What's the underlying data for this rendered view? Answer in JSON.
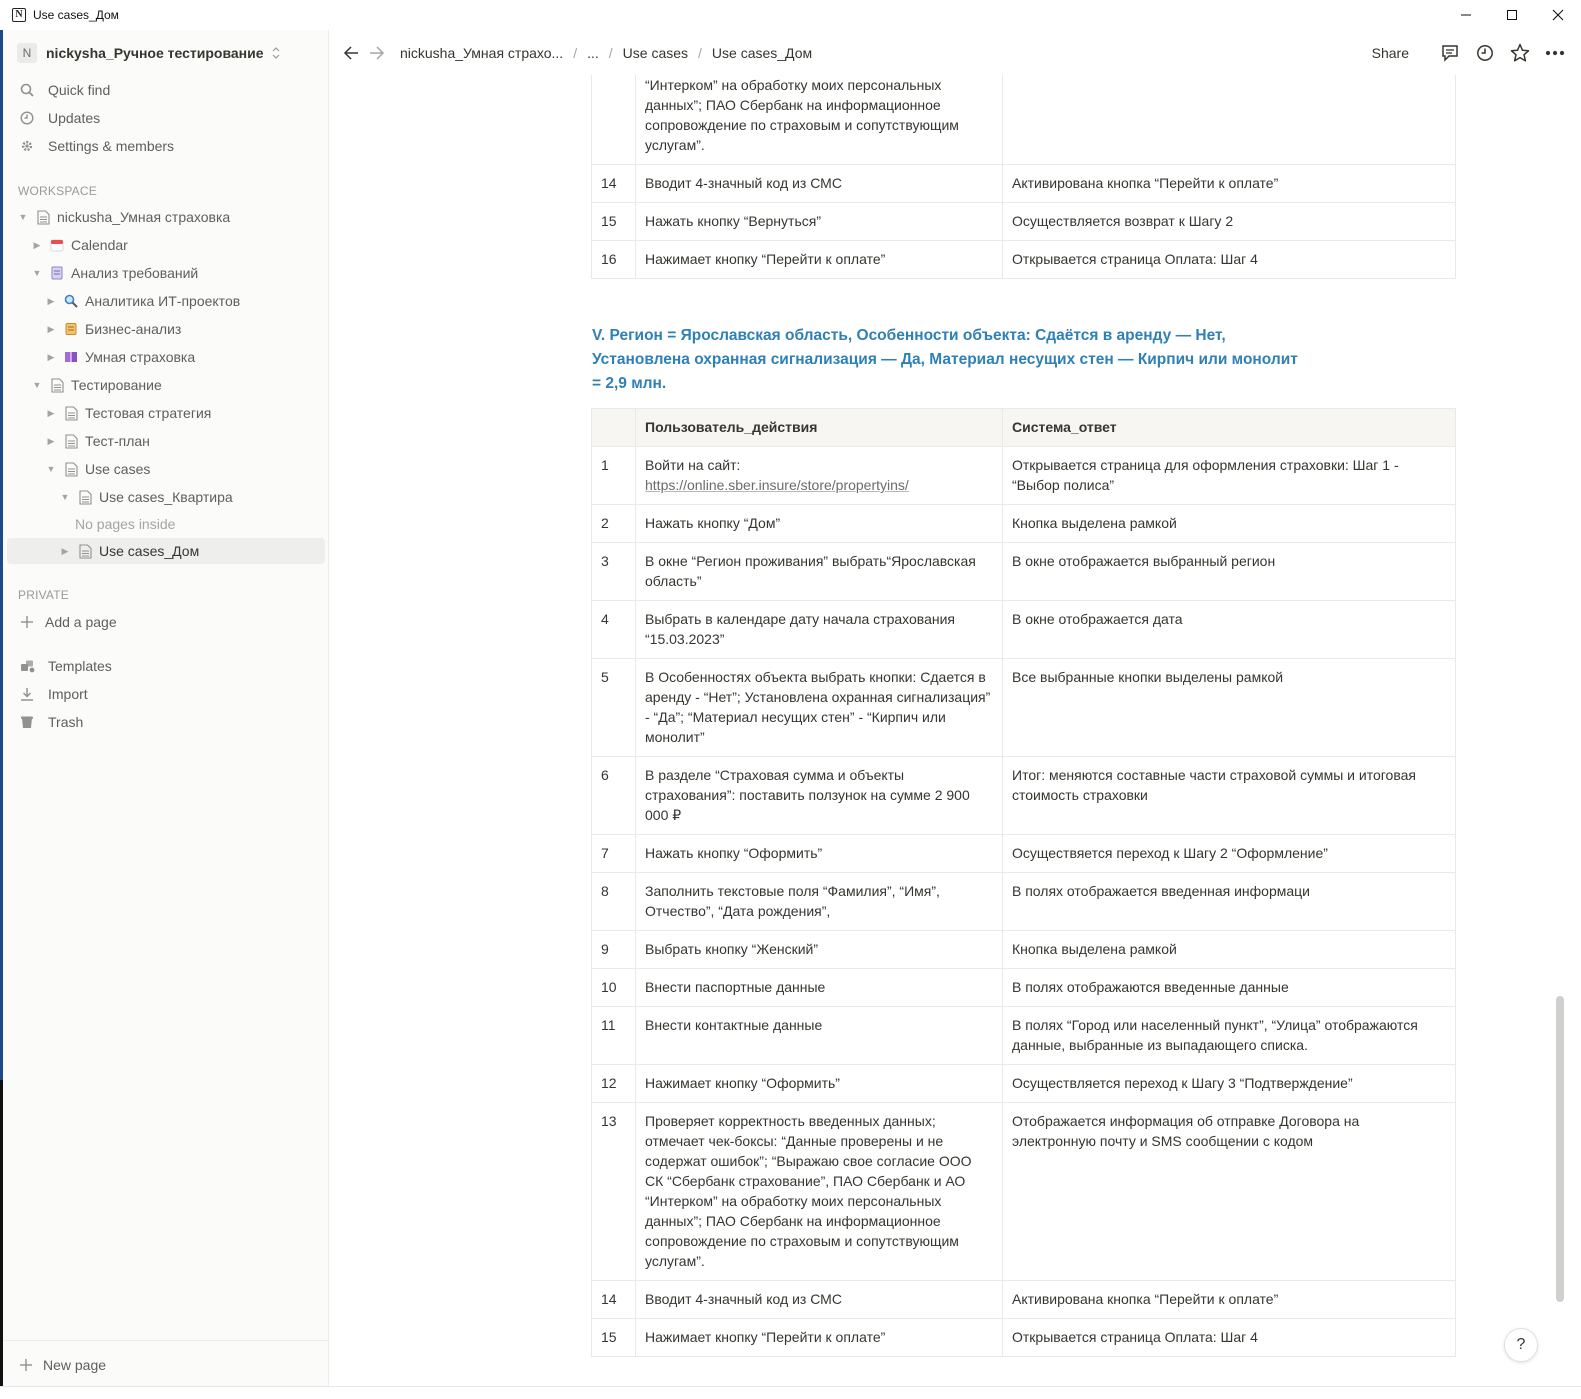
{
  "window": {
    "title": "Use cases_Дом",
    "app_icon_letter": "N"
  },
  "sidebar": {
    "workspace_initial": "N",
    "workspace_name": "nickysha_Ручное тестирование",
    "actions": [
      {
        "label": "Quick find",
        "icon": "search-icon"
      },
      {
        "label": "Updates",
        "icon": "clock-icon"
      },
      {
        "label": "Settings & members",
        "icon": "gear-icon"
      }
    ],
    "workspace_label": "WORKSPACE",
    "tree": [
      {
        "label": "nickusha_Умная страховка",
        "icon": "page-icon",
        "expanded": true
      },
      {
        "label": "Calendar",
        "icon": "calendar-icon",
        "expanded": false
      },
      {
        "label": "Анализ требований",
        "icon": "notes-icon",
        "expanded": true
      },
      {
        "label": "Аналитика ИТ-проектов",
        "icon": "magnifier-icon",
        "expanded": false
      },
      {
        "label": "Бизнес-анализ",
        "icon": "scroll-icon",
        "expanded": false
      },
      {
        "label": "Умная страховка",
        "icon": "book-icon",
        "expanded": false
      },
      {
        "label": "Тестирование",
        "icon": "page-icon",
        "expanded": true
      },
      {
        "label": "Тестовая стратегия",
        "icon": "page-icon",
        "expanded": false
      },
      {
        "label": "Тест-план",
        "icon": "page-icon",
        "expanded": false
      },
      {
        "label": "Use cases",
        "icon": "page-icon",
        "expanded": true
      },
      {
        "label": "Use cases_Квартира",
        "icon": "page-icon",
        "expanded": true
      },
      {
        "label": "Use cases_Дом",
        "icon": "page-icon",
        "expanded": false,
        "active": true
      }
    ],
    "no_pages_text": "No pages inside",
    "private_label": "PRIVATE",
    "add_page": "Add a page",
    "bottom_actions": [
      {
        "label": "Templates",
        "icon": "templates-icon"
      },
      {
        "label": "Import",
        "icon": "import-icon"
      },
      {
        "label": "Trash",
        "icon": "trash-icon"
      }
    ],
    "new_page": "New page"
  },
  "topbar": {
    "breadcrumbs": [
      "nickusha_Умная страхо...",
      "...",
      "Use cases",
      "Use cases_Дом"
    ],
    "share": "Share"
  },
  "main": {
    "top_table_rows": [
      {
        "num": "",
        "action": "“Интерком” на обработку моих персональных данных”; ПАО Сбербанк на информационное сопровождение по страховым и сопутствующим услугам”.",
        "result": ""
      },
      {
        "num": "14",
        "action": "Вводит 4-значный код из СМС",
        "result": "Активирована кнопка “Перейти к оплате”"
      },
      {
        "num": "15",
        "action": "Нажать кнопку “Вернуться”",
        "result": "Осуществляется возврат к Шагу 2"
      },
      {
        "num": "16",
        "action": "Нажимает кнопку “Перейти к оплате”",
        "result": "Открывается страница Оплата: Шаг 4"
      }
    ],
    "heading": "V. Регион = Ярославская область, Особенности объекта: Сдаётся в аренду — Нет, Установлена охранная сигнализация — Да, Материал несущих стен — Кирпич или монолит = 2,9 млн.",
    "table_header": {
      "num": "",
      "action": "Пользователь_действия",
      "result": "Система_ответ"
    },
    "table_rows": [
      {
        "num": "1",
        "action": "Войти на сайт:",
        "link": "https://online.sber.insure/store/propertyins/",
        "result": "Открывается страница для оформления страховки: Шаг 1 - “Выбор полиса”"
      },
      {
        "num": "2",
        "action": "Нажать кнопку “Дом”",
        "result": "Кнопка выделена рамкой"
      },
      {
        "num": "3",
        "action": "В окне “Регион проживания” выбрать“Ярославская область”",
        "result": "В окне отображается выбранный регион"
      },
      {
        "num": "4",
        "action": "Выбрать в календаре дату начала страхования “15.03.2023”",
        "result": "В окне отображается дата"
      },
      {
        "num": "5",
        "action": "В Особенностях объекта выбрать кнопки: Сдается в аренду - “Нет”; Установлена охранная сигнализация” - “Да”; “Материал несущих стен” - “Кирпич или монолит”",
        "result": "Все выбранные кнопки выделены рамкой"
      },
      {
        "num": "6",
        "action": "В разделе “Страховая сумма и объекты страхования”: поставить ползунок на сумме 2 900 000 ₽",
        "result": "Итог: меняются составные части страховой суммы и итоговая стоимость страховки"
      },
      {
        "num": "7",
        "action": "Нажать кнопку “Оформить”",
        "result": "Осуществяется переход  к Шагу 2 “Оформление”"
      },
      {
        "num": "8",
        "action": "Заполнить текстовые поля “Фамилия”, “Имя”, Отчество”, “Дата рождения”,",
        "result": "В полях отображается введенная информаци"
      },
      {
        "num": "9",
        "action": "Выбрать кнопку “Женский”",
        "result": "Кнопка выделена рамкой"
      },
      {
        "num": "10",
        "action": "Внести паспортные данные",
        "result": "В полях отображаются введенные данные"
      },
      {
        "num": "11",
        "action": "Внести контактные данные",
        "result": "В полях “Город или населенный пункт”, “Улица” отображаются данные, выбранные из выпадающего списка."
      },
      {
        "num": "12",
        "action": "Нажимает кнопку “Оформить”",
        "result": "Осуществляется переход к Шагу 3 “Подтверждение”"
      },
      {
        "num": "13",
        "action": "Проверяет корректность введенных данных; отмечает чек-боксы: “Данные проверены и не содержат ошибок”; “Выражаю свое согласие ООО СК “Сбербанк страхование”, ПАО Сбербанк и АО “Интерком” на обработку моих персональных данных”; ПАО Сбербанк на информационное сопровождение по страховым и сопутствующим услугам”.",
        "result": "Отображается информация об отправке Договора на электронную почту и SMS сообщении с кодом"
      },
      {
        "num": "14",
        "action": "Вводит 4-значный код из СМС",
        "result": "Активирована кнопка “Перейти к оплате”"
      },
      {
        "num": "15",
        "action": "Нажимает кнопку “Перейти к оплате”",
        "result": "Открывается страница Оплата: Шаг 4"
      }
    ]
  },
  "help_label": "?",
  "colors": {
    "heading": "#2e80b6",
    "sidebar_bg": "#fbfbfa",
    "header_bg": "#f7f6f3",
    "border": "#e9e9e7"
  }
}
